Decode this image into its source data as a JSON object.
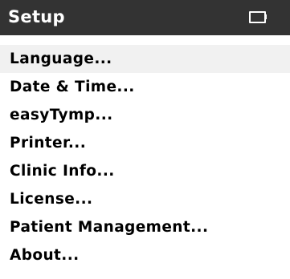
{
  "header": {
    "title": "Setup",
    "status_icon": "battery-icon"
  },
  "menu": {
    "selected_index": 0,
    "items": [
      {
        "label": "Language..."
      },
      {
        "label": "Date & Time..."
      },
      {
        "label": "easyTymp..."
      },
      {
        "label": "Printer..."
      },
      {
        "label": "Clinic Info..."
      },
      {
        "label": "License..."
      },
      {
        "label": "Patient Management..."
      },
      {
        "label": "About..."
      }
    ]
  }
}
